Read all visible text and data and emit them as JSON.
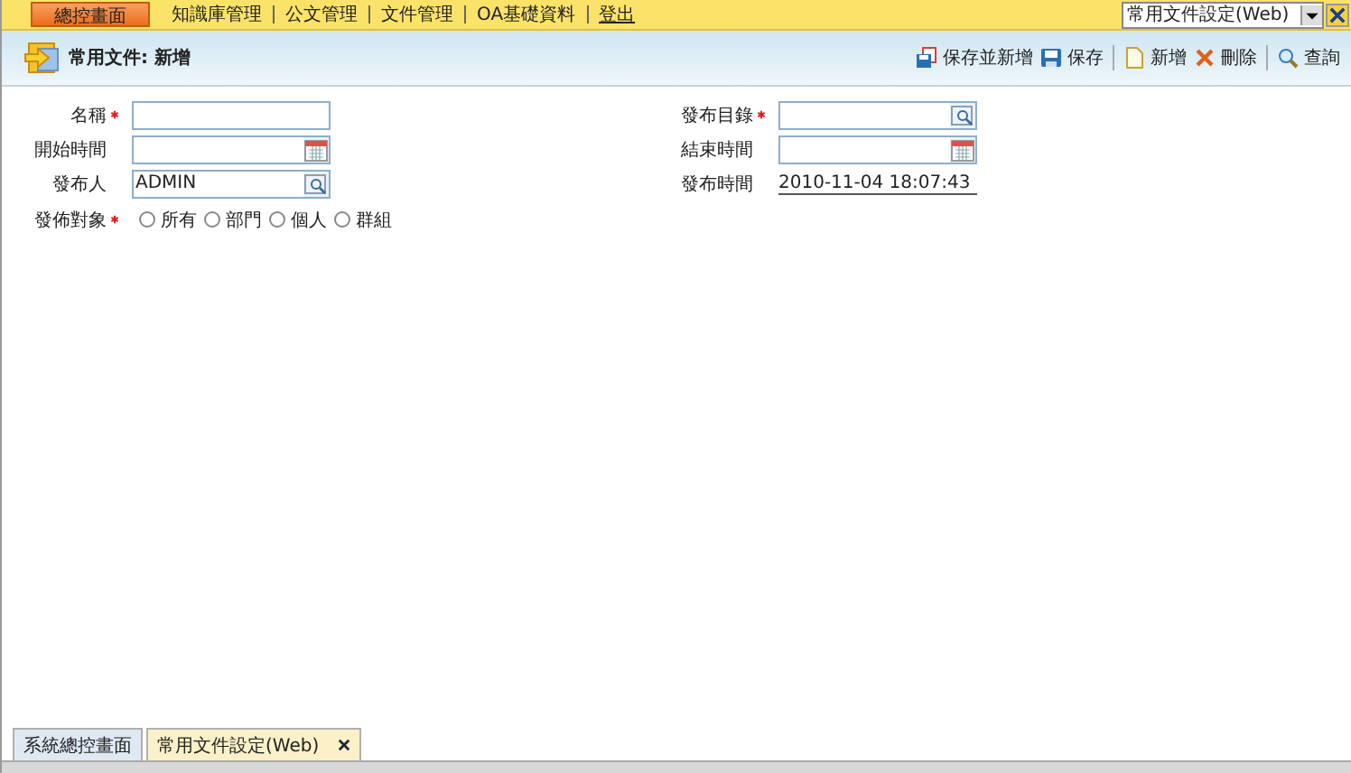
{
  "top_menu": [
    {
      "label": "總控畫面",
      "selected": true
    },
    {
      "label": "知識庫管理",
      "selected": false
    },
    {
      "label": "公文管理",
      "selected": false
    },
    {
      "label": "文件管理",
      "selected": false
    },
    {
      "label": "OA基礎資料",
      "selected": false
    },
    {
      "label": "登出",
      "selected": false
    }
  ],
  "window_select": {
    "value": "常用文件設定(Web)"
  },
  "page_title": "常用文件: 新增",
  "toolbar": [
    {
      "kind": "save-new",
      "label": "保存並新增"
    },
    {
      "kind": "save",
      "label": "保存"
    },
    {
      "kind": "new",
      "label": "新增"
    },
    {
      "kind": "delete",
      "label": "刪除"
    },
    {
      "kind": "query",
      "label": "查詢"
    }
  ],
  "fields": [
    {
      "label": "名稱",
      "required": true,
      "kind": "text"
    },
    {
      "label": "發布目錄",
      "required": true,
      "kind": "lookup"
    },
    {
      "label": "開始時間",
      "required": false,
      "kind": "date"
    },
    {
      "label": "結束時間",
      "required": false,
      "kind": "date"
    },
    {
      "label": "發布人",
      "required": false,
      "kind": "lookup",
      "value": "ADMIN"
    },
    {
      "label": "發布時間",
      "required": false,
      "kind": "readonly",
      "value": "2010-11-04 18:07:43"
    }
  ],
  "audience": {
    "label": "發佈對象",
    "required": true,
    "options": [
      {
        "label": "所有",
        "selected": false
      },
      {
        "label": "部門",
        "selected": false
      },
      {
        "label": "個人",
        "selected": false
      },
      {
        "label": "群組",
        "selected": false
      }
    ]
  },
  "bottom_tabs": [
    {
      "label": "系統總控畫面",
      "selected": false,
      "closable": false
    },
    {
      "label": "常用文件設定(Web)",
      "selected": true,
      "closable": true
    }
  ]
}
